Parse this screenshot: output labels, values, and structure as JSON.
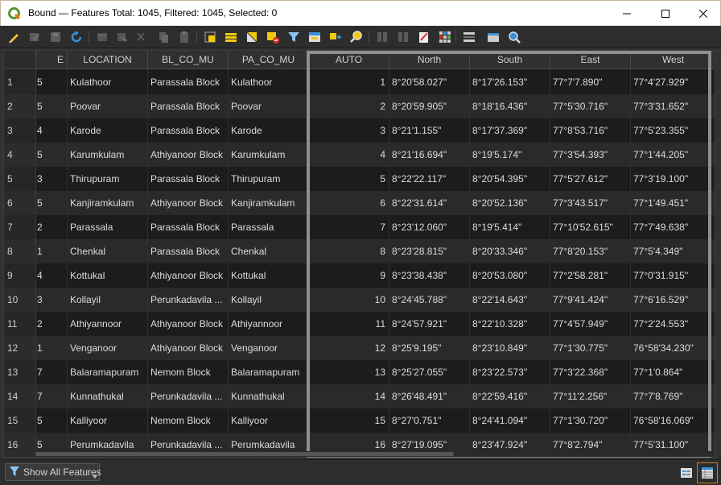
{
  "window": {
    "title": "Bound — Features Total: 1045, Filtered: 1045, Selected: 0",
    "app_icon": "qgis-logo-icon",
    "controls": [
      "minimize-icon",
      "maximize-icon",
      "close-icon"
    ]
  },
  "toolbar": {
    "icons": [
      "toggle-editing-icon",
      "toggle-multi-edit-icon",
      "save-edits-icon",
      "reload-table-icon",
      "add-feature-icon",
      "delete-feature-icon",
      "cut-icon",
      "copy-icon",
      "paste-icon",
      "select-by-expression-icon",
      "select-all-icon",
      "invert-selection-icon",
      "deselect-all-icon",
      "filter-select-icon",
      "move-selection-top-icon",
      "pan-to-selected-icon",
      "zoom-to-selected-icon",
      "new-field-icon",
      "delete-field-icon",
      "field-calculator-icon",
      "conditional-formatting-icon",
      "dock-table-icon",
      "actions-icon",
      "zoom-map-icon"
    ]
  },
  "table": {
    "columns": [
      "E",
      "LOCATION",
      "BL_CO_MU",
      "PA_CO_MU",
      "AUTO",
      "North",
      "South",
      "East",
      "West"
    ],
    "rows": [
      {
        "n": "1",
        "e": "5",
        "location": "Kulathoor",
        "bl": "Parassala Block",
        "pa": "Kulathoor",
        "auto": "1",
        "north": "8°20'58.027\"",
        "south": "8°17'26.153\"",
        "east": "77°7'7.890\"",
        "west": "77°4'27.929\""
      },
      {
        "n": "2",
        "e": "5",
        "location": "Poovar",
        "bl": "Parassala Block",
        "pa": "Poovar",
        "auto": "2",
        "north": "8°20'59.905\"",
        "south": "8°18'16.436\"",
        "east": "77°5'30.716\"",
        "west": "77°3'31.652\""
      },
      {
        "n": "3",
        "e": "4",
        "location": "Karode",
        "bl": "Parassala Block",
        "pa": "Karode",
        "auto": "3",
        "north": "8°21'1.155\"",
        "south": "8°17'37.369\"",
        "east": "77°8'53.716\"",
        "west": "77°5'23.355\""
      },
      {
        "n": "4",
        "e": "5",
        "location": "Karumkulam",
        "bl": "Athiyanoor Block",
        "pa": "Karumkulam",
        "auto": "4",
        "north": "8°21'16.694\"",
        "south": "8°19'5.174\"",
        "east": "77°3'54.393\"",
        "west": "77°1'44.205\""
      },
      {
        "n": "5",
        "e": "3",
        "location": "Thirupuram",
        "bl": "Parassala Block",
        "pa": "Thirupuram",
        "auto": "5",
        "north": "8°22'22.117\"",
        "south": "8°20'54.395\"",
        "east": "77°5'27.612\"",
        "west": "77°3'19.100\""
      },
      {
        "n": "6",
        "e": "5",
        "location": "Kanjiramkulam",
        "bl": "Athiyanoor Block",
        "pa": "Kanjiramkulam",
        "auto": "6",
        "north": "8°22'31.614\"",
        "south": "8°20'52.136\"",
        "east": "77°3'43.517\"",
        "west": "77°1'49.451\""
      },
      {
        "n": "7",
        "e": "2",
        "location": "Parassala",
        "bl": "Parassala Block",
        "pa": "Parassala",
        "auto": "7",
        "north": "8°23'12.060\"",
        "south": "8°19'5.414\"",
        "east": "77°10'52.615\"",
        "west": "77°7'49.638\""
      },
      {
        "n": "8",
        "e": "1",
        "location": "Chenkal",
        "bl": "Parassala Block",
        "pa": "Chenkal",
        "auto": "8",
        "north": "8°23'28.815\"",
        "south": "8°20'33.346\"",
        "east": "77°8'20.153\"",
        "west": "77°5'4.349\""
      },
      {
        "n": "9",
        "e": "4",
        "location": "Kottukal",
        "bl": "Athiyanoor Block",
        "pa": "Kottukal",
        "auto": "9",
        "north": "8°23'38.438\"",
        "south": "8°20'53.080\"",
        "east": "77°2'58.281\"",
        "west": "77°0'31.915\""
      },
      {
        "n": "10",
        "e": "3",
        "location": "Kollayil",
        "bl": "Perunkadavila ...",
        "pa": "Kollayil",
        "auto": "10",
        "north": "8°24'45.788\"",
        "south": "8°22'14.643\"",
        "east": "77°9'41.424\"",
        "west": "77°6'16.529\""
      },
      {
        "n": "11",
        "e": "2",
        "location": "Athiyannoor",
        "bl": "Athiyanoor Block",
        "pa": "Athiyannoor",
        "auto": "11",
        "north": "8°24'57.921\"",
        "south": "8°22'10.328\"",
        "east": "77°4'57.949\"",
        "west": "77°2'24.553\""
      },
      {
        "n": "12",
        "e": "1",
        "location": "Venganoor",
        "bl": "Athiyanoor Block",
        "pa": "Venganoor",
        "auto": "12",
        "north": "8°25'9.195\"",
        "south": "8°23'10.849\"",
        "east": "77°1'30.775\"",
        "west": "76°58'34.230\""
      },
      {
        "n": "13",
        "e": "7",
        "location": "Balaramapuram",
        "bl": "Nemom Block",
        "pa": "Balaramapuram",
        "auto": "13",
        "north": "8°25'27.055\"",
        "south": "8°23'22.573\"",
        "east": "77°3'22.368\"",
        "west": "77°1'0.864\""
      },
      {
        "n": "14",
        "e": "7",
        "location": "Kunnathukal",
        "bl": "Perunkadavila ...",
        "pa": "Kunnathukal",
        "auto": "14",
        "north": "8°26'48.491\"",
        "south": "8°22'59.416\"",
        "east": "77°11'2.256\"",
        "west": "77°7'8.769\""
      },
      {
        "n": "15",
        "e": "5",
        "location": "Kalliyoor",
        "bl": "Nemom Block",
        "pa": "Kalliyoor",
        "auto": "15",
        "north": "8°27'0.751\"",
        "south": "8°24'41.094\"",
        "east": "77°1'30.720\"",
        "west": "76°58'16.069\""
      },
      {
        "n": "16",
        "e": "5",
        "location": "Perumkadavila",
        "bl": "Perunkadavila ...",
        "pa": "Perumkadavila",
        "auto": "16",
        "north": "8°27'19.095\"",
        "south": "8°23'47.924\"",
        "east": "77°8'2.794\"",
        "west": "77°5'31.100\""
      }
    ]
  },
  "footer": {
    "show_features_label": "Show All Features",
    "filter_icon": "filter-icon",
    "form_view_icon": "form-view-icon",
    "table_view_icon": "table-view-icon"
  },
  "colors": {
    "accent": "#c8831b",
    "highlight_border": "#8f8f8f",
    "row_odd": "#1c1c1c",
    "row_even": "#2a2a2a"
  }
}
